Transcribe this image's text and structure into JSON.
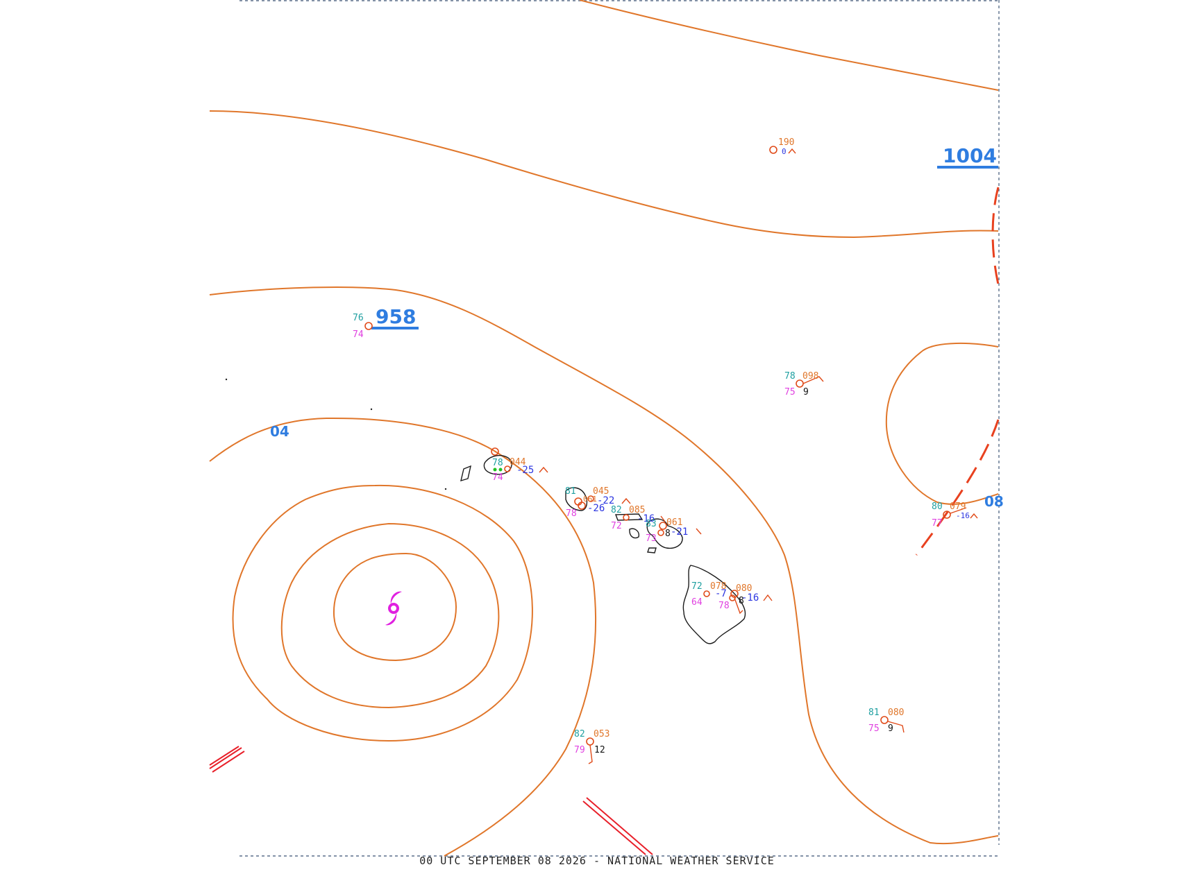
{
  "footer": {
    "caption": "00 UTC SEPTEMBER 08 2026 - NATIONAL WEATHER SERVICE"
  },
  "pressure_labels": {
    "high": "1004",
    "center": "958",
    "west": "04",
    "east": "08"
  },
  "stations": {
    "ne": {
      "pressure": "190",
      "tendency": "0"
    },
    "nw": {
      "temp": "76",
      "dew": "74"
    },
    "east": {
      "temp": "78",
      "pressure": "098",
      "dew": "75",
      "vis": "9"
    },
    "far_east": {
      "temp": "80",
      "pressure": "079",
      "dew": "77",
      "tendency": "-16"
    },
    "kauai": {
      "temp": "78",
      "pressure": "044",
      "dew": "74",
      "tendency": "-25"
    },
    "oahu": {
      "temp": "81",
      "pressure": "045",
      "dew": "78",
      "tendency1": "-22",
      "p2": "061",
      "tendency2": "-26"
    },
    "molokai": {
      "temp": "82",
      "pressure": "085",
      "dew": "72",
      "tendency": "-16"
    },
    "maui": {
      "temp": "83",
      "pressure": "061",
      "dew": "73",
      "tendency": "-21",
      "extra": "8"
    },
    "big_island_w": {
      "temp": "72",
      "pressure": "078",
      "dew": "64",
      "tendency": "-7"
    },
    "big_island_e": {
      "temp": "",
      "pressure": "080",
      "dew": "78",
      "tendency": "-16",
      "extra": "8"
    },
    "south": {
      "temp": "82",
      "pressure": "053",
      "dew": "79",
      "vis": "12"
    },
    "southeast": {
      "temp": "81",
      "pressure": "080",
      "dew": "75",
      "vis": "9"
    }
  },
  "colors": {
    "isobar": "#e0762a",
    "pressure_label": "#2f7de0",
    "hurricane": "#e020e0",
    "front": "#e8411f"
  },
  "icons": {
    "storm": "hurricane-symbol-icon",
    "station": "station-circle-icon"
  }
}
